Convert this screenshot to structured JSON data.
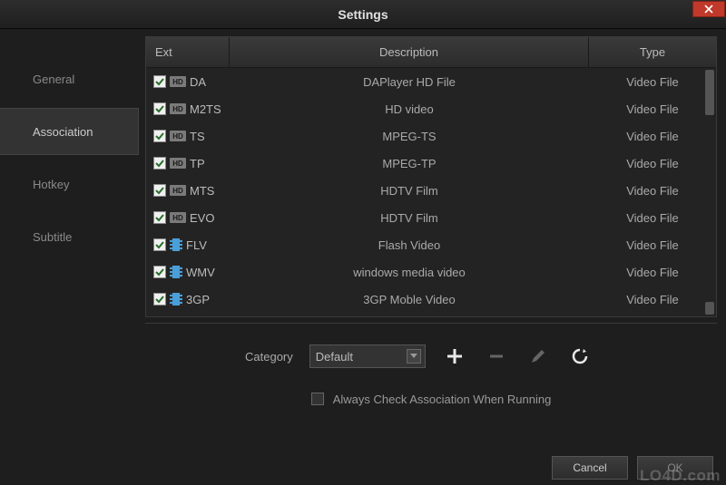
{
  "title": "Settings",
  "sidebar": {
    "items": [
      {
        "label": "General"
      },
      {
        "label": "Association"
      },
      {
        "label": "Hotkey"
      },
      {
        "label": "Subtitle"
      }
    ],
    "activeIndex": 1
  },
  "table": {
    "headers": {
      "ext": "Ext",
      "desc": "Description",
      "type": "Type"
    },
    "rows": [
      {
        "checked": true,
        "iconType": "hd",
        "ext": "DA",
        "desc": "DAPlayer HD File",
        "type": "Video File"
      },
      {
        "checked": true,
        "iconType": "hd",
        "ext": "M2TS",
        "desc": "HD video",
        "type": "Video File"
      },
      {
        "checked": true,
        "iconType": "hd",
        "ext": "TS",
        "desc": "MPEG-TS",
        "type": "Video File"
      },
      {
        "checked": true,
        "iconType": "hd",
        "ext": "TP",
        "desc": "MPEG-TP",
        "type": "Video File"
      },
      {
        "checked": true,
        "iconType": "hd",
        "ext": "MTS",
        "desc": "HDTV Film",
        "type": "Video File"
      },
      {
        "checked": true,
        "iconType": "hd",
        "ext": "EVO",
        "desc": "HDTV Film",
        "type": "Video File"
      },
      {
        "checked": true,
        "iconType": "film",
        "ext": "FLV",
        "desc": "Flash Video",
        "type": "Video File"
      },
      {
        "checked": true,
        "iconType": "film",
        "ext": "WMV",
        "desc": "windows media video",
        "type": "Video File"
      },
      {
        "checked": true,
        "iconType": "film",
        "ext": "3GP",
        "desc": "3GP Moble Video",
        "type": "Video File"
      }
    ]
  },
  "toolbar": {
    "categoryLabel": "Category",
    "categoryValue": "Default"
  },
  "alwaysCheck": {
    "checked": false,
    "label": "Always Check Association When Running"
  },
  "buttons": {
    "cancel": "Cancel",
    "ok": "OK"
  },
  "hdBadge": "HD",
  "watermark": "LO4D.com"
}
